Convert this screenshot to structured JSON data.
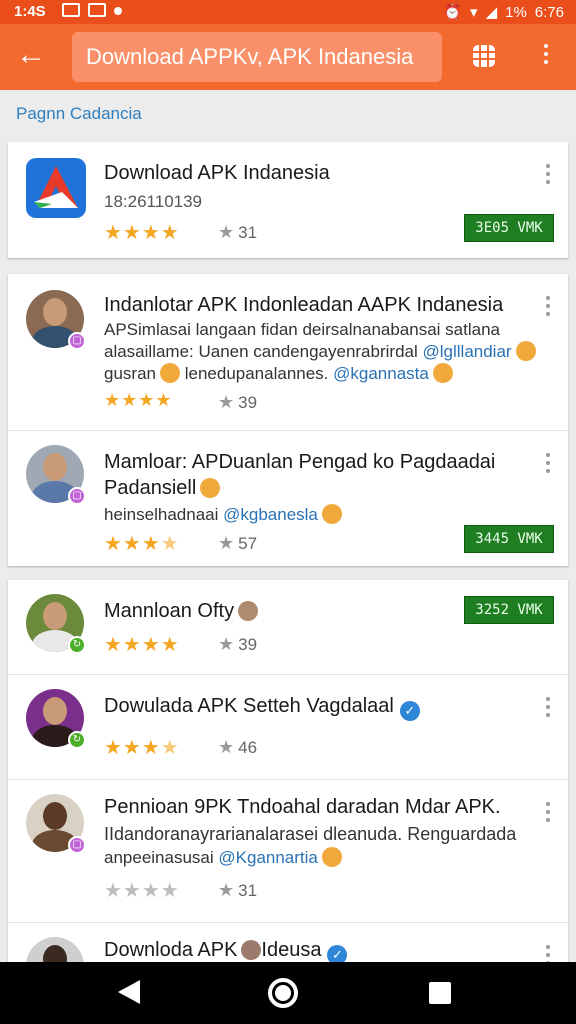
{
  "status_bar": {
    "time": "1:4S",
    "battery": "1%",
    "clock": "6:76"
  },
  "toolbar": {
    "search_text": "Download APPKv, APK Indanesia"
  },
  "section": {
    "label": "Pagnn Cadancia"
  },
  "top_app": {
    "title": "Download APK Indanesia",
    "subtitle": "18:26110139",
    "rating": 4,
    "count": "31",
    "price": "3E05 VMK"
  },
  "reviews_a": [
    {
      "title": "Indanlotar APK Indonleadan AAPK Indanesia",
      "lines": [
        "APSimlasai langaan fidan deirsalnanabansai satlana",
        "alasaillame: Uanen candengayenrabrirdal"
      ],
      "line2_mention": "@lglllandiar",
      "line3": "gusran",
      "line3_rest": "lenedupanalannes.",
      "line3_mention": "@kgannasta",
      "rating": "4",
      "count": "39"
    },
    {
      "title": "Mamloar: APDuanlan Pengad ko Pagdaadai",
      "title2": "Padansiell",
      "desc": "heinselhadnaai",
      "mention": "@kgbanesla",
      "rating": "3.5",
      "count": "57",
      "price": "3445 VMK"
    }
  ],
  "reviews_b": [
    {
      "title": "Mannloan Ofty",
      "rating": "4",
      "count": "39",
      "price": "3252 VMK"
    },
    {
      "title": "Dowulada APK Setteh Vagdalaal",
      "rating": "3.5",
      "count": "46"
    },
    {
      "title": "Pennioan 9PK Tndoahal daradan Mdar APK.",
      "line2": "IIdandoranayrarianalarasei dleanuda. Renguardada",
      "line3": "anpeeinasusai",
      "mention": "@Kgannartia",
      "rating": "0",
      "count": "31"
    },
    {
      "title": "Downloda APK",
      "title_rest": "Ideusa"
    }
  ]
}
